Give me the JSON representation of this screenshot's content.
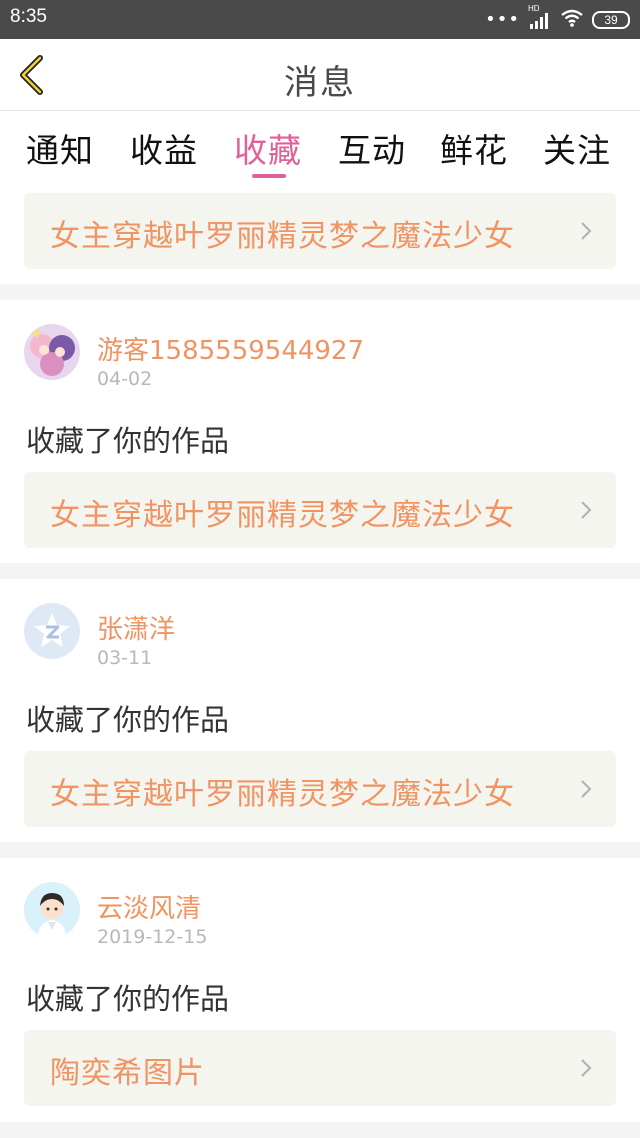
{
  "status_bar": {
    "time": "8:35",
    "battery": "39",
    "network_label": "HD"
  },
  "header": {
    "title": "消息"
  },
  "tabs": [
    {
      "label": "通知",
      "active": false
    },
    {
      "label": "收益",
      "active": false
    },
    {
      "label": "收藏",
      "active": true
    },
    {
      "label": "互动",
      "active": false
    },
    {
      "label": "鲜花",
      "active": false
    },
    {
      "label": "关注",
      "active": false
    }
  ],
  "items": [
    {
      "work_title": "女主穿越叶罗丽精灵梦之魔法少女"
    },
    {
      "username": "游客1585559544927",
      "date": "04-02",
      "action": "收藏了你的作品",
      "work_title": "女主穿越叶罗丽精灵梦之魔法少女",
      "avatar_icon": "anime-avatar"
    },
    {
      "username": "张潇洋",
      "date": "03-11",
      "action": "收藏了你的作品",
      "work_title": "女主穿越叶罗丽精灵梦之魔法少女",
      "avatar_icon": "default-star-avatar"
    },
    {
      "username": "云淡风清",
      "date": "2019-12-15",
      "action": "收藏了你的作品",
      "work_title": "陶奕希图片",
      "avatar_icon": "boy-avatar"
    }
  ],
  "colors": {
    "accent": "#e0609a",
    "link": "#ef9462",
    "muted": "#b8b8b8",
    "card_bg": "#f5f5f0"
  }
}
